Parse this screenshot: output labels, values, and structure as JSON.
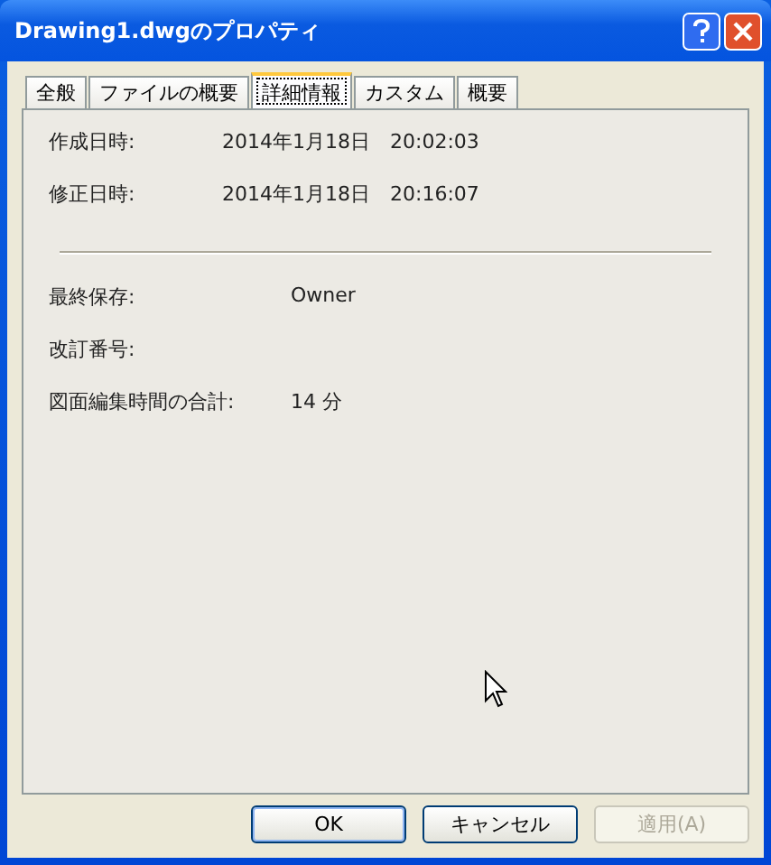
{
  "window": {
    "title": "Drawing1.dwgのプロパティ"
  },
  "tabs": [
    {
      "label": "全般",
      "selected": false
    },
    {
      "label": "ファイルの概要",
      "selected": false
    },
    {
      "label": "詳細情報",
      "selected": true
    },
    {
      "label": "カスタム",
      "selected": false
    },
    {
      "label": "概要",
      "selected": false
    }
  ],
  "sections": [
    {
      "rows": [
        {
          "label": "作成日時:",
          "value": "2014年1月18日　20:02:03"
        },
        {
          "label": "修正日時:",
          "value": "2014年1月18日　20:16:07"
        }
      ]
    },
    {
      "rows": [
        {
          "label": "最終保存:",
          "value": "Owner"
        },
        {
          "label": "改訂番号:"
        },
        {
          "label": "図面編集時間の合計:",
          "value": "14 分"
        }
      ]
    }
  ],
  "buttons": [
    {
      "label": "OK",
      "default": true,
      "disabled": false
    },
    {
      "label": "キャンセル",
      "default": false,
      "disabled": false
    },
    {
      "label": "適用(A)",
      "default": false,
      "disabled": true
    }
  ]
}
